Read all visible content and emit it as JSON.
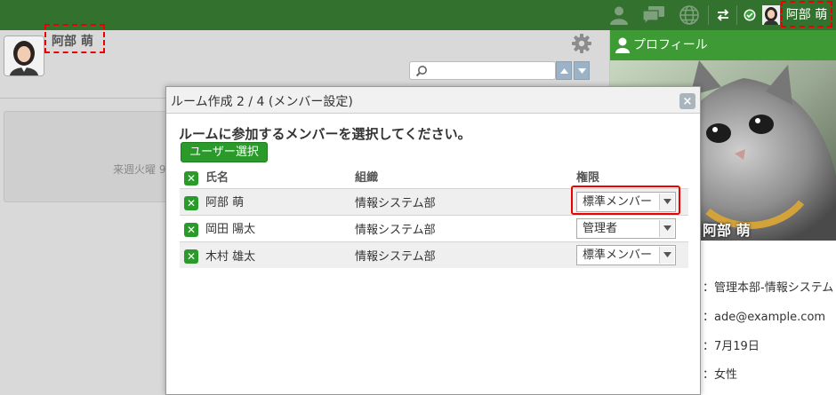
{
  "header": {
    "user_name": "阿部 萌"
  },
  "left": {
    "user_name": "阿部 萌",
    "calendar_text": "来週火曜 9"
  },
  "dialog": {
    "title": "ルーム作成 2 / 4 (メンバー設定)",
    "close_label": "×",
    "instruction": "ルームに参加するメンバーを選択してください。",
    "user_select_button": "ユーザー選択",
    "columns": {
      "name": "氏名",
      "org": "組織",
      "role": "権限"
    },
    "members": [
      {
        "name": "阿部 萌",
        "org": "情報システム部",
        "role": "標準メンバー"
      },
      {
        "name": "岡田 陽太",
        "org": "情報システム部",
        "role": "管理者"
      },
      {
        "name": "木村 雄太",
        "org": "情報システム部",
        "role": "標準メンバー"
      }
    ]
  },
  "profile": {
    "header": "プロフィール",
    "name": "阿部 萌",
    "department": "：管理本部-情報システム",
    "email": "：ade@example.com",
    "birthday": "：7月19日",
    "gender": "：女性"
  },
  "colors": {
    "topbar": "#33722e",
    "profile_header": "#3e9a35",
    "accent_button": "#2a9a2a",
    "highlight_red": "#e00000"
  },
  "icons": [
    "person-icon",
    "chat-icon",
    "globe-icon",
    "swap-icon",
    "status-check-icon",
    "gear-icon",
    "search-icon",
    "close-icon",
    "remove-member-icon",
    "chevron-down-icon"
  ]
}
